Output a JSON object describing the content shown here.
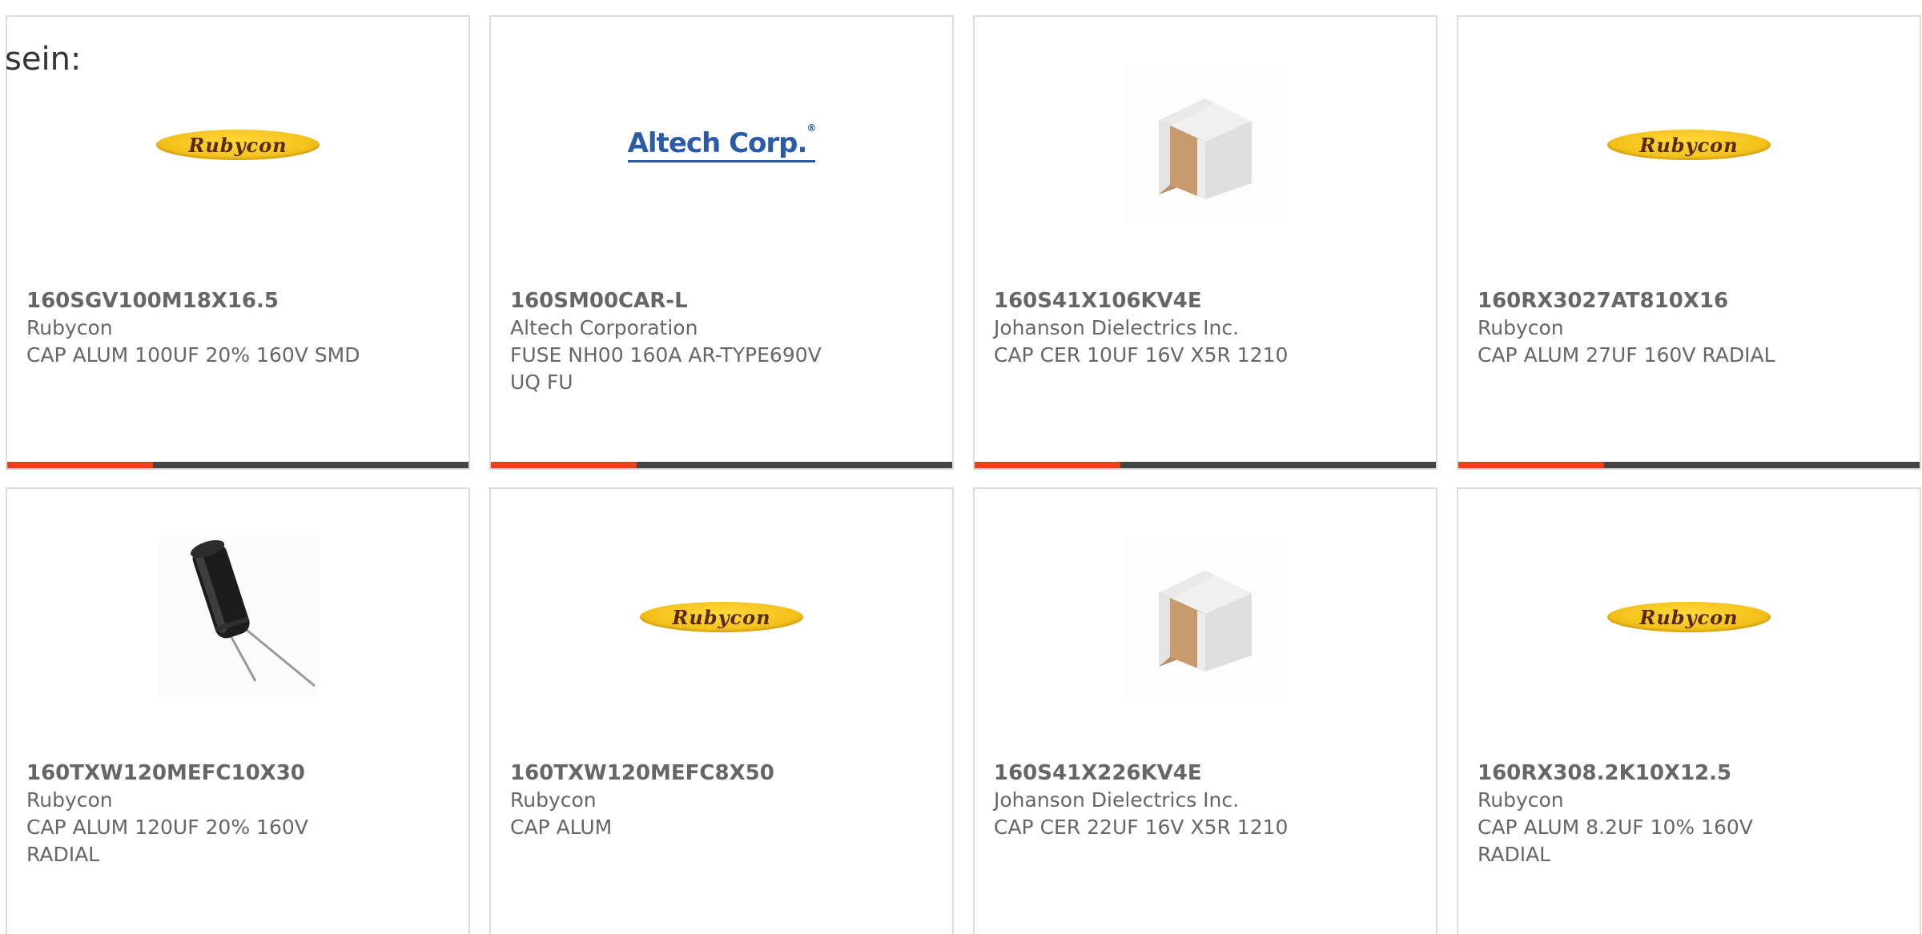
{
  "intro_text": "sein:",
  "products": [
    {
      "part_number": "160SGV100M18X16.5",
      "manufacturer": "Rubycon",
      "description": "CAP ALUM 100UF 20% 160V SMD",
      "image": "rubycon-logo",
      "logo_text": "Rubycon"
    },
    {
      "part_number": "160SM00CAR-L",
      "manufacturer": "Altech Corporation",
      "description": "FUSE NH00 160A AR-TYPE690V UQ FU",
      "image": "altech-logo",
      "logo_text": "Altech Corp."
    },
    {
      "part_number": "160S41X106KV4E",
      "manufacturer": "Johanson Dielectrics Inc.",
      "description": "CAP CER 10UF 16V X5R 1210",
      "image": "ceramic-capacitor-photo",
      "logo_text": ""
    },
    {
      "part_number": "160RX3027AT810X16",
      "manufacturer": "Rubycon",
      "description": "CAP ALUM 27UF 160V RADIAL",
      "image": "rubycon-logo",
      "logo_text": "Rubycon"
    },
    {
      "part_number": "160TXW120MEFC10X30",
      "manufacturer": "Rubycon",
      "description": "CAP ALUM 120UF 20% 160V RADIAL",
      "image": "electrolytic-capacitor-photo",
      "logo_text": ""
    },
    {
      "part_number": "160TXW120MEFC8X50",
      "manufacturer": "Rubycon",
      "description": "CAP ALUM",
      "image": "rubycon-logo",
      "logo_text": "Rubycon"
    },
    {
      "part_number": "160S41X226KV4E",
      "manufacturer": "Johanson Dielectrics Inc.",
      "description": "CAP CER 22UF 16V X5R 1210",
      "image": "ceramic-capacitor-photo",
      "logo_text": ""
    },
    {
      "part_number": "160RX308.2K10X12.5",
      "manufacturer": "Rubycon",
      "description": "CAP ALUM 8.2UF 10% 160V RADIAL",
      "image": "rubycon-logo",
      "logo_text": "Rubycon"
    }
  ],
  "colors": {
    "accent_bar": "#e8411c",
    "bar_base": "#444444",
    "card_border": "#dcdcdc",
    "text": "#666666"
  }
}
